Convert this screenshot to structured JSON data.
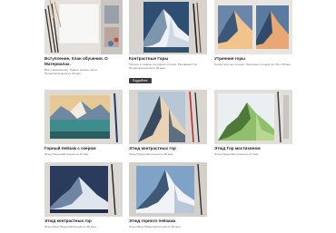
{
  "lessons": [
    {
      "title": "Вступление, план обучения. О Материалах.",
      "desc": "Всё о материалах: бумага, краски, кисти\nПродолжительность 16 мин",
      "badge": ""
    },
    {
      "title": "Контрастные Горы",
      "desc": "Теплые и темные холодные оттенки, Рисование Гор\nПродолжительность 36 мин",
      "badge": "Подробнее"
    },
    {
      "title": "Утренние горы",
      "desc": "Серия простых этюдов. Несколько этюдов гор 18 и 30 мин",
      "badge": ""
    },
    {
      "title": "Горный пейзаж с озером",
      "desc": "Этюд Продолжительность 45 мин",
      "badge": ""
    },
    {
      "title": "Этюд контрастных гор",
      "desc": "Этюд Продолжительность 60 мин",
      "badge": ""
    },
    {
      "title": "Этюд Гор мастихином",
      "desc": "Этюд Продолжительность 27 мин",
      "badge": ""
    },
    {
      "title": "Этюд контрастных гор",
      "desc": "Этюд Язык Продолжительность 30 мин",
      "badge": ""
    },
    {
      "title": "Этюд горного пейзажа",
      "desc": "Этюд Язык Продолжительность 30 мин",
      "badge": ""
    }
  ],
  "colors": {
    "badge_bg": "#3a3a3a",
    "title": "#1b1b1b",
    "desc": "#6a6a6a"
  }
}
